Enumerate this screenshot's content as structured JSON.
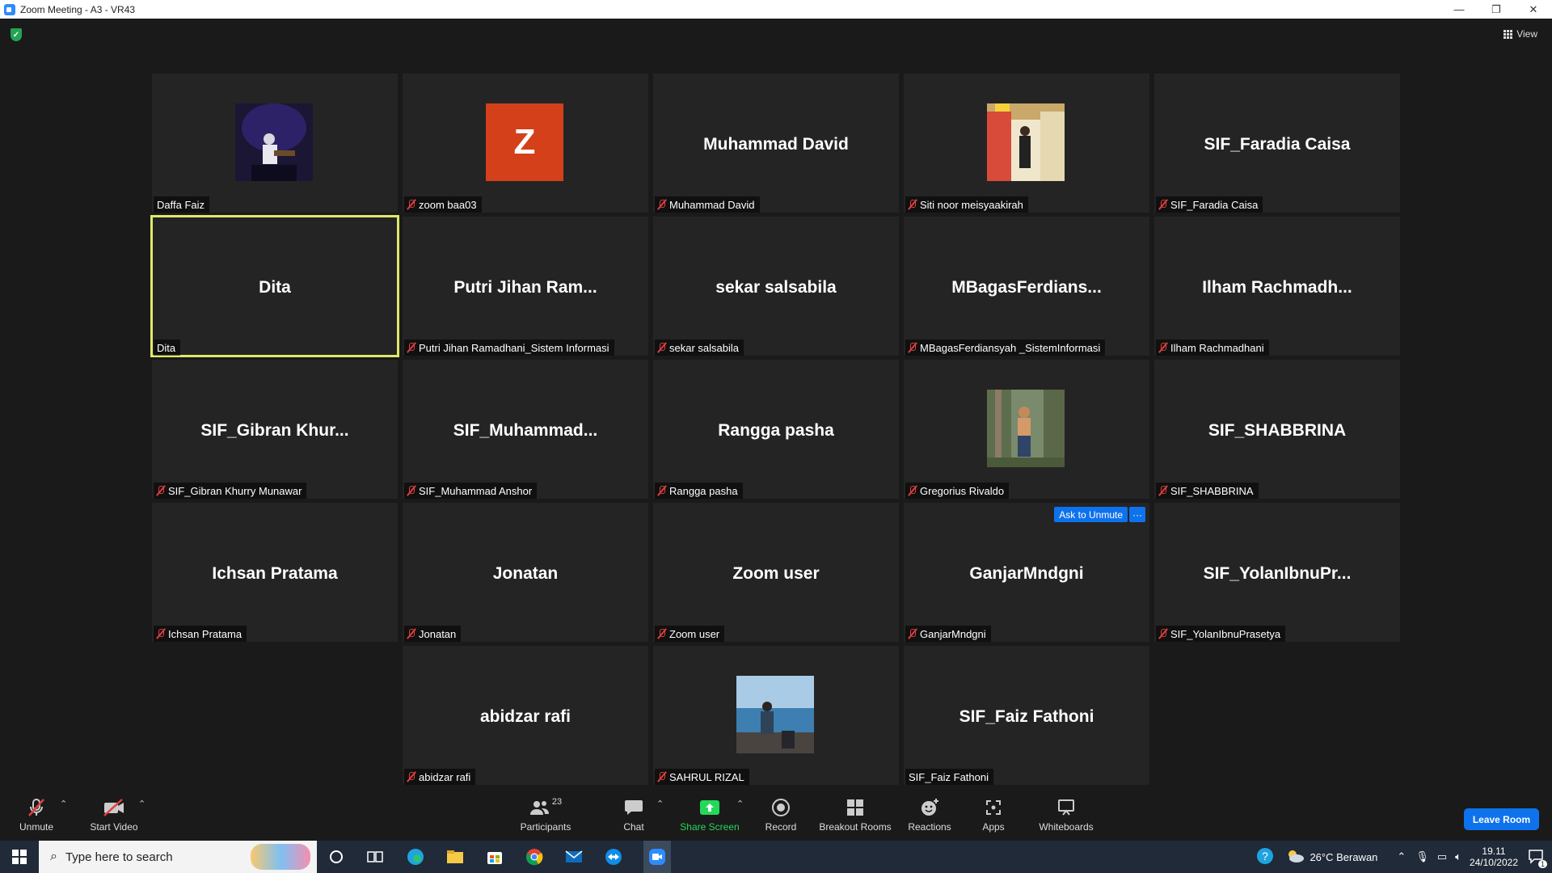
{
  "window": {
    "title": "Zoom Meeting - A3 - VR43",
    "min": "—",
    "max": "❐",
    "close": "✕"
  },
  "view_label": "View",
  "participants": [
    {
      "big": "",
      "label": "Daffa Faiz",
      "muted": false,
      "avatar": "photo-concert"
    },
    {
      "big": "",
      "label": "zoom baa03",
      "muted": true,
      "avatar": "Z"
    },
    {
      "big": "Muhammad David",
      "label": "Muhammad David",
      "muted": true
    },
    {
      "big": "",
      "label": "Siti noor meisyaakirah",
      "muted": true,
      "avatar": "photo-supermarket"
    },
    {
      "big": "SIF_Faradia Caisa",
      "label": "SIF_Faradia Caisa",
      "muted": true
    },
    {
      "big": "Dita",
      "label": "Dita",
      "muted": false,
      "active": true
    },
    {
      "big": "Putri Jihan Ram...",
      "label": "Putri Jihan Ramadhani_Sistem Informasi",
      "muted": true
    },
    {
      "big": "sekar salsabila",
      "label": "sekar salsabila",
      "muted": true
    },
    {
      "big": "MBagasFerdians...",
      "label": "MBagasFerdiansyah _SistemInformasi",
      "muted": true
    },
    {
      "big": "Ilham  Rachmadh...",
      "label": "Ilham Rachmadhani",
      "muted": true
    },
    {
      "big": "SIF_Gibran  Khur...",
      "label": "SIF_Gibran Khurry Munawar",
      "muted": true
    },
    {
      "big": "SIF_Muhammad...",
      "label": "SIF_Muhammad Anshor",
      "muted": true
    },
    {
      "big": "Rangga pasha",
      "label": "Rangga pasha",
      "muted": true
    },
    {
      "big": "",
      "label": "Gregorius Rivaldo",
      "muted": true,
      "avatar": "photo-forest"
    },
    {
      "big": "SIF_SHABBRINA",
      "label": "SIF_SHABBRINA",
      "muted": true
    },
    {
      "big": "Ichsan Pratama",
      "label": "Ichsan Pratama",
      "muted": true
    },
    {
      "big": "Jonatan",
      "label": "Jonatan",
      "muted": true
    },
    {
      "big": "Zoom user",
      "label": "Zoom user",
      "muted": true
    },
    {
      "big": "GanjarMndgni",
      "label": "GanjarMndgni",
      "muted": true,
      "ask": "Ask to Unmute",
      "more": "···"
    },
    {
      "big": "SIF_YolanIbnuPr...",
      "label": "SIF_YolanIbnuPrasetya",
      "muted": true
    },
    {
      "big": "abidzar rafi",
      "label": "abidzar rafi",
      "muted": true
    },
    {
      "big": "",
      "label": "SAHRUL RIZAL",
      "muted": true,
      "avatar": "photo-sea"
    },
    {
      "big": "SIF_Faiz Fathoni",
      "label": "SIF_Faiz Fathoni",
      "muted": false
    }
  ],
  "toolbar": {
    "unmute": "Unmute",
    "start_video": "Start Video",
    "participants": "Participants",
    "participant_count": "23",
    "chat": "Chat",
    "share_screen": "Share Screen",
    "record": "Record",
    "breakout_rooms": "Breakout Rooms",
    "reactions": "Reactions",
    "apps": "Apps",
    "whiteboards": "Whiteboards",
    "leave": "Leave Room"
  },
  "taskbar": {
    "search_placeholder": "Type here to search",
    "weather": "26°C  Berawan",
    "time": "19.11",
    "date": "24/10/2022",
    "notifications": "1"
  },
  "colors": {
    "accent": "#0e72ed",
    "active_speaker": "#dfe86a",
    "share_green": "#23d959",
    "muted_red": "#e03e3e"
  }
}
